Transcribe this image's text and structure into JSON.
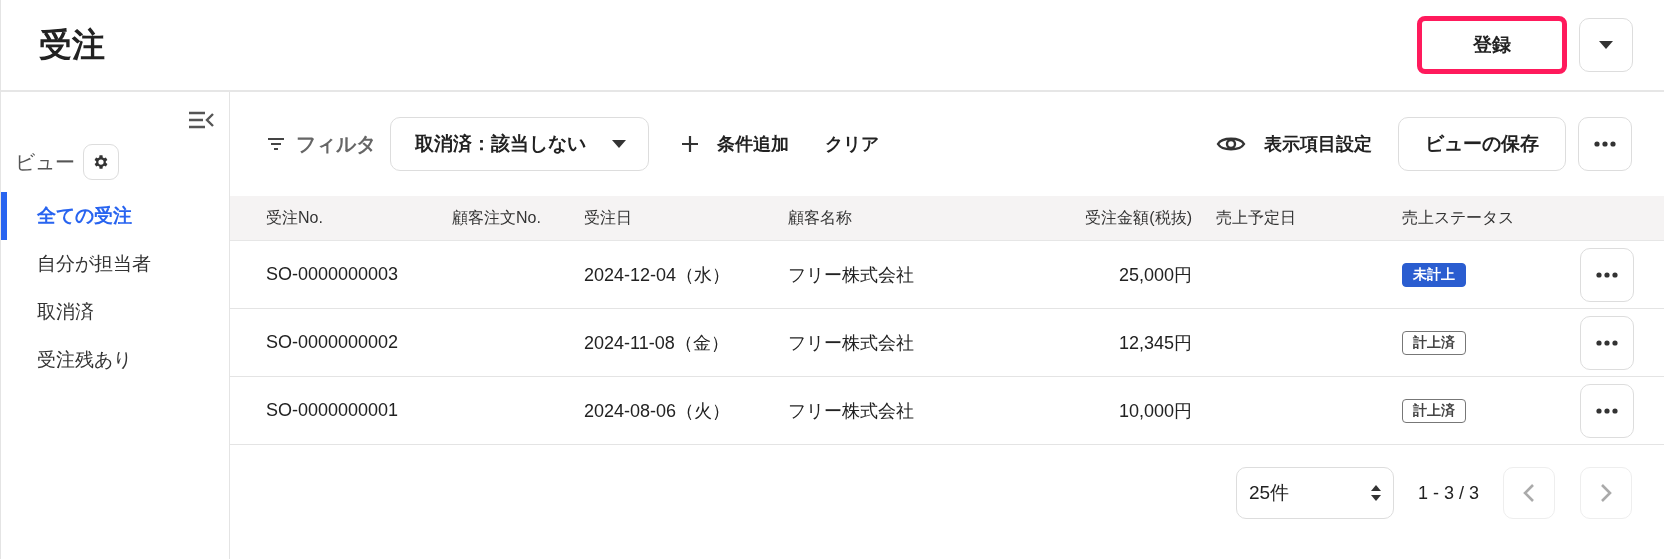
{
  "page_title": "受注",
  "header_actions": {
    "primary": "登録"
  },
  "sidebar": {
    "heading": "ビュー",
    "items": [
      {
        "label": "全ての受注",
        "selected": true
      },
      {
        "label": "自分が担当者",
        "selected": false
      },
      {
        "label": "取消済",
        "selected": false
      },
      {
        "label": "受注残あり",
        "selected": false
      }
    ]
  },
  "toolbar": {
    "filter_label": "フィルタ",
    "filter_chip": "取消済：該当しない",
    "add_condition": "条件追加",
    "clear": "クリア",
    "column_settings": "表示項目設定",
    "save_view": "ビューの保存"
  },
  "table": {
    "columns": [
      "受注No.",
      "顧客注文No.",
      "受注日",
      "顧客名称",
      "受注金額(税抜)",
      "売上予定日",
      "売上ステータス"
    ],
    "rows": [
      {
        "order_no": "SO-0000000003",
        "order_date": "2024-12-04（水）",
        "customer": "フリー株式会社",
        "amount": "25,000円",
        "status": {
          "label": "未計上",
          "kind": "pending"
        }
      },
      {
        "order_no": "SO-0000000002",
        "order_date": "2024-11-08（金）",
        "customer": "フリー株式会社",
        "amount": "12,345円",
        "status": {
          "label": "計上済",
          "kind": "done"
        }
      },
      {
        "order_no": "SO-0000000001",
        "order_date": "2024-08-06（火）",
        "customer": "フリー株式会社",
        "amount": "10,000円",
        "status": {
          "label": "計上済",
          "kind": "done"
        }
      }
    ]
  },
  "pagination": {
    "page_size": "25件",
    "range": "1 - 3 / 3",
    "prev_disabled": true,
    "next_disabled": true
  }
}
